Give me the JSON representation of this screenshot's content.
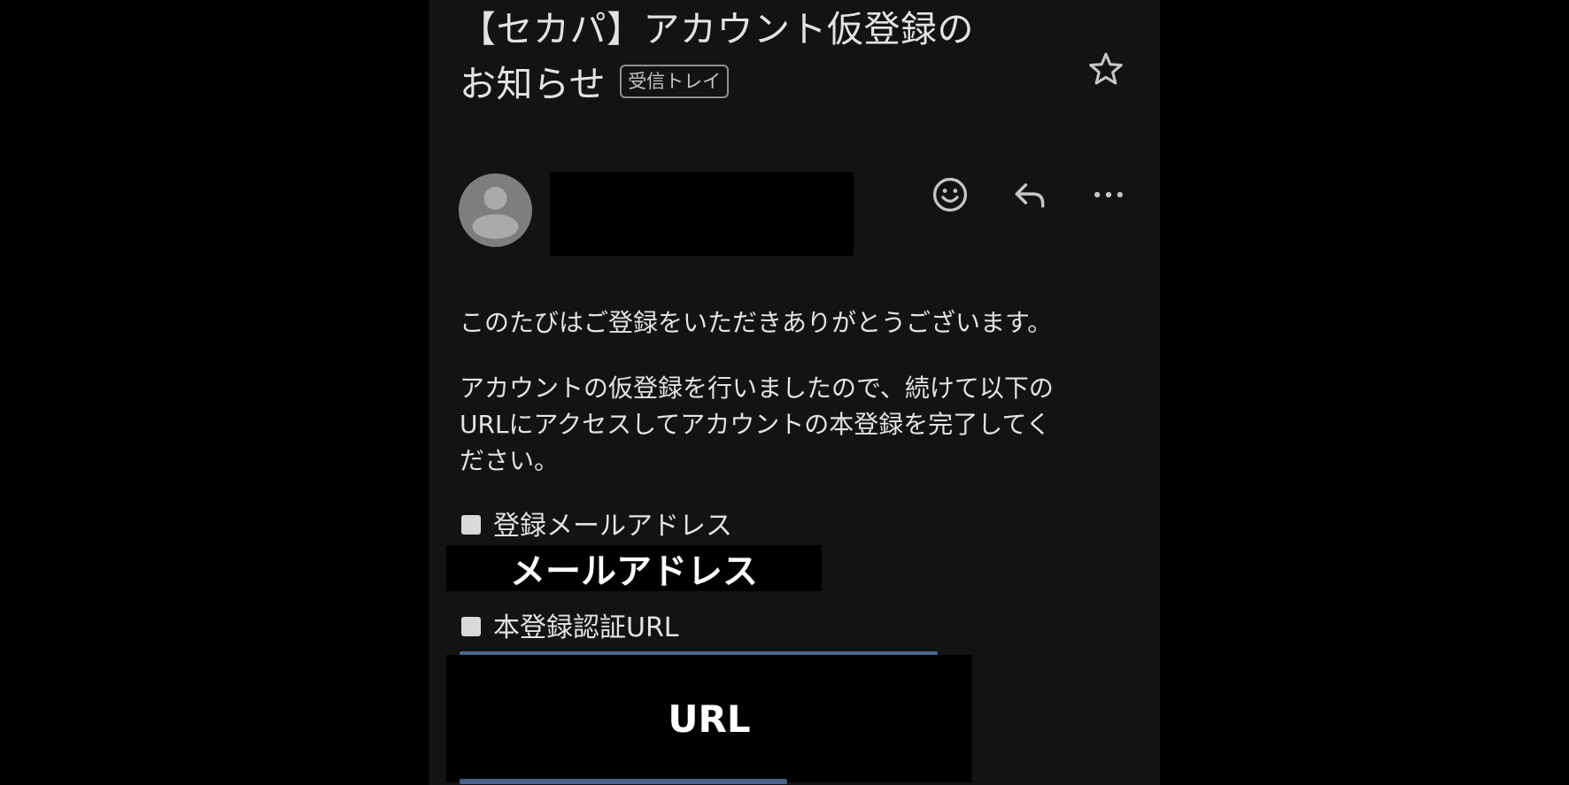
{
  "email": {
    "subject_line1": "【セカパ】アカウント仮登録の",
    "subject_line2": "お知らせ",
    "label_badge": "受信トレイ",
    "star_icon": "star-outline-icon",
    "avatar_icon": "person-placeholder-icon",
    "actions": [
      {
        "icon": "emoji-reaction-icon"
      },
      {
        "icon": "reply-icon"
      },
      {
        "icon": "more-options-icon"
      }
    ],
    "body": {
      "paragraph1": "このたびはご登録をいただきありがとうございます。",
      "paragraph2_lines": [
        "アカウントの仮登録を行いましたので、続けて以下の",
        "URLにアクセスしてアカウントの本登録を完了してく",
        "ださい。"
      ],
      "email_label": "登録メールアドレス",
      "email_value_redacted": "メールアドレス",
      "url_label": "本登録認証URL",
      "url_value_redacted": "URL"
    }
  },
  "colors": {
    "background": "#131314",
    "text": "#e3e3e3",
    "link": "#7cacf8",
    "redaction": "#000000"
  }
}
